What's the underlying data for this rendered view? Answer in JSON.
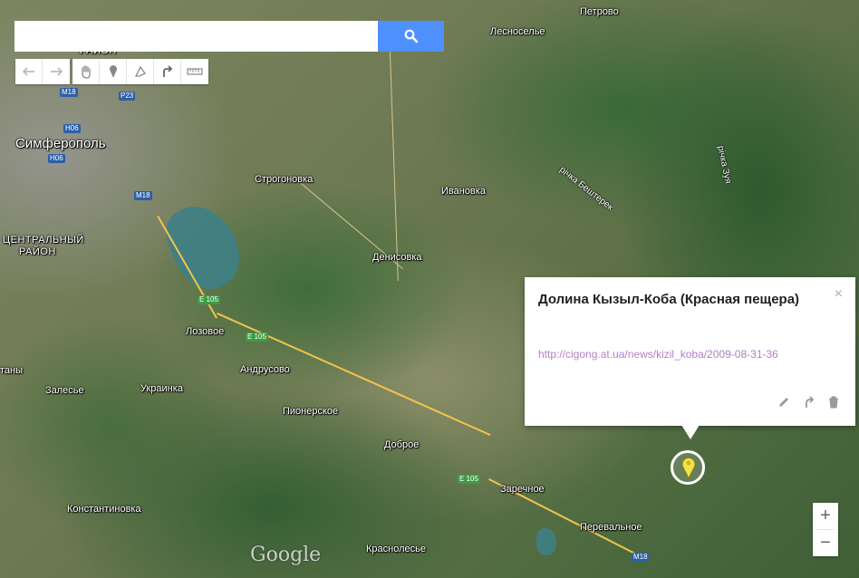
{
  "search": {
    "value": "",
    "placeholder": ""
  },
  "search_button_icon": "search-icon",
  "toolbar_left": [
    {
      "name": "undo-button",
      "icon": "undo-icon"
    },
    {
      "name": "redo-button",
      "icon": "redo-icon"
    }
  ],
  "toolbar_right": [
    {
      "name": "pan-button",
      "icon": "hand-icon"
    },
    {
      "name": "add-marker-button",
      "icon": "marker-icon"
    },
    {
      "name": "draw-line-button",
      "icon": "polygon-icon"
    },
    {
      "name": "directions-button",
      "icon": "directions-arrow-icon"
    },
    {
      "name": "measure-button",
      "icon": "ruler-icon"
    }
  ],
  "places": {
    "petrovo": "Петрово",
    "lesnoselye": "Лесноселье",
    "simferopol": "Симферополь",
    "raion_top": "РАЙОН",
    "tsentralny_1": "ЦЕНТРАЛЬНЫЙ",
    "tsentralny_2": "РАЙОН",
    "stroganovka": "Строгоновка",
    "ivanovka": "Ивановка",
    "denisovka": "Денисовка",
    "lozovoe": "Лозовое",
    "andrusovo": "Андрусово",
    "tany": "таны",
    "zalesye": "Залесье",
    "ukrainka": "Украинка",
    "pionerskoe": "Пионерское",
    "dobroe": "Доброе",
    "zarechnoe": "Заречное",
    "konstantinovka": "Константиновка",
    "perevalnoe": "Перевальное",
    "krasnolesye": "Краснолесье"
  },
  "rivers": {
    "beshterek": "річка Бештерек",
    "zuya": "річка Зуя"
  },
  "road_shields": {
    "m18_a": "M18",
    "p23": "P23",
    "h06_a": "H06",
    "h06_b": "H06",
    "m18_b": "M18",
    "e105_a": "E 105",
    "e105_b": "E 105",
    "e105_c": "E 105",
    "m18_c": "M18"
  },
  "attribution": "Google",
  "info_window": {
    "title": "Долина Кызыл-Коба (Красная пещера)",
    "link": "http://cigong.at.ua/news/kizil_koba/2009-08-31-36",
    "close": "×"
  },
  "zoom": {
    "in": "+",
    "out": "−"
  },
  "colors": {
    "search_button": "#4d90fe",
    "link": "#b47ec7",
    "marker": "#f4e24a",
    "road_major": "#f3c34b"
  }
}
